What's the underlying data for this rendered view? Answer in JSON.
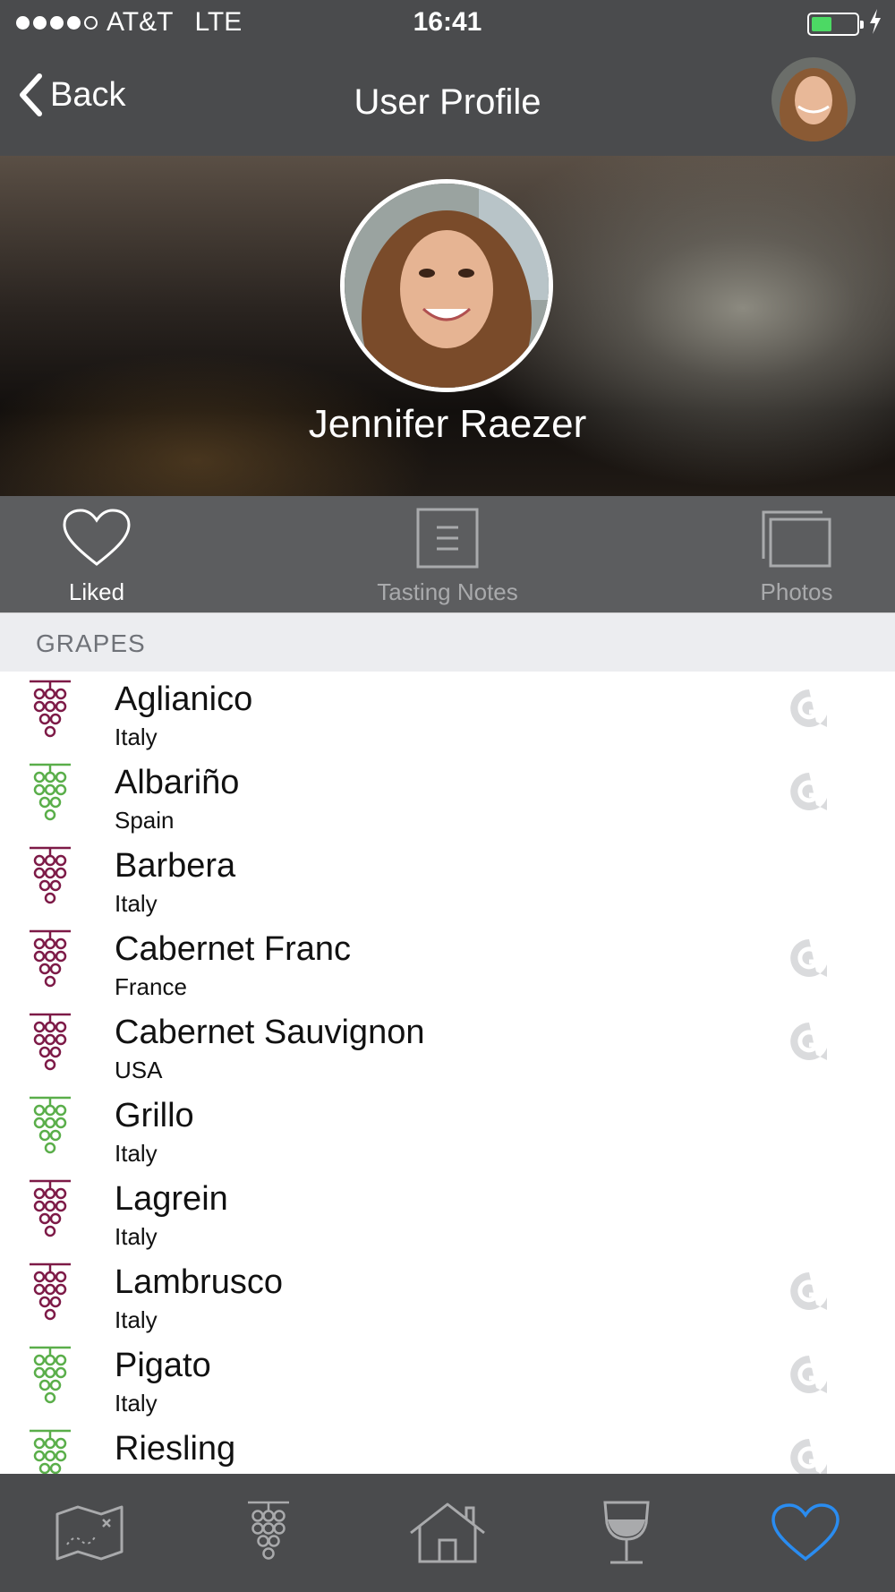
{
  "status_bar": {
    "carrier": "AT&T",
    "network": "LTE",
    "time": "16:41",
    "battery_color": "#4cd964"
  },
  "nav": {
    "back_label": "Back",
    "title": "User Profile"
  },
  "profile": {
    "name": "Jennifer Raezer"
  },
  "tabs": [
    {
      "label": "Liked",
      "icon": "heart-icon",
      "active": true
    },
    {
      "label": "Tasting Notes",
      "icon": "notes-icon",
      "active": false
    },
    {
      "label": "Photos",
      "icon": "photos-icon",
      "active": false
    }
  ],
  "section_header": "GRAPES",
  "colors": {
    "red_grape": "#7d1a47",
    "white_grape": "#5aae4a",
    "accent_blue": "#2a8cf0"
  },
  "grapes": [
    {
      "name": "Aglianico",
      "country": "Italy",
      "type": "red",
      "badge": true
    },
    {
      "name": "Albariño",
      "country": "Spain",
      "type": "white",
      "badge": true
    },
    {
      "name": "Barbera",
      "country": "Italy",
      "type": "red",
      "badge": false
    },
    {
      "name": "Cabernet Franc",
      "country": "France",
      "type": "red",
      "badge": true
    },
    {
      "name": "Cabernet Sauvignon",
      "country": "USA",
      "type": "red",
      "badge": true
    },
    {
      "name": "Grillo",
      "country": "Italy",
      "type": "white",
      "badge": false
    },
    {
      "name": "Lagrein",
      "country": "Italy",
      "type": "red",
      "badge": false
    },
    {
      "name": "Lambrusco",
      "country": "Italy",
      "type": "red",
      "badge": true
    },
    {
      "name": "Pigato",
      "country": "Italy",
      "type": "white",
      "badge": true
    },
    {
      "name": "Riesling",
      "country": "",
      "type": "white",
      "badge": true
    }
  ],
  "bottom_tabs": [
    {
      "icon": "map-icon",
      "active": false
    },
    {
      "icon": "grapes-icon",
      "active": false
    },
    {
      "icon": "home-icon",
      "active": false
    },
    {
      "icon": "wine-glass-icon",
      "active": false
    },
    {
      "icon": "heart-icon",
      "active": true
    }
  ]
}
